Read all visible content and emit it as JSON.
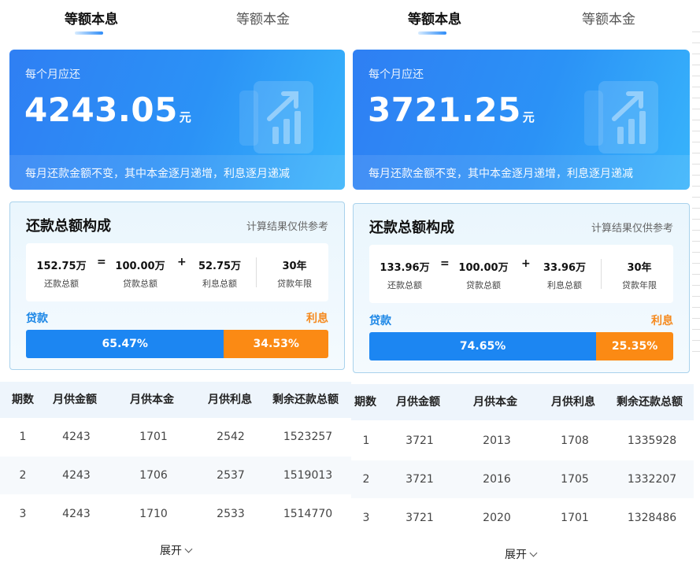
{
  "panels": [
    {
      "tabs": [
        {
          "label": "等额本息",
          "active": true
        },
        {
          "label": "等额本金",
          "active": false
        }
      ],
      "hero": {
        "label": "每个月应还",
        "amount": "4243.05",
        "unit": "元",
        "note": "每月还款金额不变，其中本金逐月递增，利息逐月递减"
      },
      "composition": {
        "title": "还款总额构成",
        "hint": "计算结果仅供参考",
        "total": {
          "value": "152.75万",
          "label": "还款总额"
        },
        "op_eq": "=",
        "principal": {
          "value": "100.00万",
          "label": "贷款总额"
        },
        "op_plus": "+",
        "interest": {
          "value": "52.75万",
          "label": "利息总额"
        },
        "term": {
          "value": "30年",
          "label": "贷款年限"
        },
        "legend_loan": "贷款",
        "legend_interest": "利息",
        "loan_pct_label": "65.47%",
        "interest_pct_label": "34.53%",
        "loan_pct": 65.47
      },
      "table": {
        "headers": [
          "期数",
          "月供金额",
          "月供本金",
          "月供利息",
          "剩余还款总额"
        ],
        "rows": [
          [
            "1",
            "4243",
            "1701",
            "2542",
            "1523257"
          ],
          [
            "2",
            "4243",
            "1706",
            "2537",
            "1519013"
          ],
          [
            "3",
            "4243",
            "1710",
            "2533",
            "1514770"
          ]
        ]
      },
      "expand_label": "展开"
    },
    {
      "tabs": [
        {
          "label": "等额本息",
          "active": true
        },
        {
          "label": "等额本金",
          "active": false
        }
      ],
      "hero": {
        "label": "每个月应还",
        "amount": "3721.25",
        "unit": "元",
        "note": "每月还款金额不变，其中本金逐月递增，利息逐月递减"
      },
      "composition": {
        "title": "还款总额构成",
        "hint": "计算结果仅供参考",
        "total": {
          "value": "133.96万",
          "label": "还款总额"
        },
        "op_eq": "=",
        "principal": {
          "value": "100.00万",
          "label": "贷款总额"
        },
        "op_plus": "+",
        "interest": {
          "value": "33.96万",
          "label": "利息总额"
        },
        "term": {
          "value": "30年",
          "label": "贷款年限"
        },
        "legend_loan": "贷款",
        "legend_interest": "利息",
        "loan_pct_label": "74.65%",
        "interest_pct_label": "25.35%",
        "loan_pct": 74.65
      },
      "table": {
        "headers": [
          "期数",
          "月供金额",
          "月供本金",
          "月供利息",
          "剩余还款总额"
        ],
        "rows": [
          [
            "1",
            "3721",
            "2013",
            "1708",
            "1335928"
          ],
          [
            "2",
            "3721",
            "2016",
            "1705",
            "1332207"
          ],
          [
            "3",
            "3721",
            "2020",
            "1701",
            "1328486"
          ]
        ]
      },
      "expand_label": "展开"
    }
  ]
}
